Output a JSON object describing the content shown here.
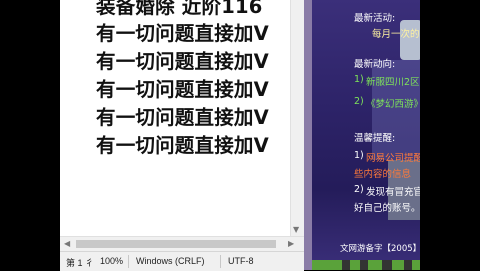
{
  "editor": {
    "lines": [
      "装备婚除 近阶116",
      "有一切问题直接加V",
      "有一切问题直接加V",
      "有一切问题直接加V",
      "有一切问题直接加V",
      "有一切问题直接加V"
    ]
  },
  "statusbar": {
    "position": "第 1 彳",
    "zoom": "100%",
    "line_ending": "Windows (CRLF)",
    "encoding": "UTF-8"
  },
  "game_panel": {
    "latest_activity_title": "最新活动:",
    "latest_activity_text": "每月一次的",
    "latest_news_title": "最新动向:",
    "news_1_index": "1)",
    "news_1_text": "新服四川2区",
    "news_2_index": "2)",
    "news_2_text": "《梦幻西游》",
    "warm_tip_title": "温馨提醒:",
    "tip_1_index": "1)",
    "tip_1_text_a": "网易公司提醒",
    "tip_1_text_b": "些内容的信息",
    "tip_2_index": "2)",
    "tip_2_text_a": "发现有冒充官",
    "tip_2_text_b": "好自己的账号。",
    "footer": "文网游备字【2005】"
  },
  "colors": {
    "panel_title": "#ffffff",
    "activity_text": "#fff2a0",
    "news_green": "#7ee35a",
    "tip_orange": "#ff7a3a",
    "tip_white": "#ffffff"
  }
}
